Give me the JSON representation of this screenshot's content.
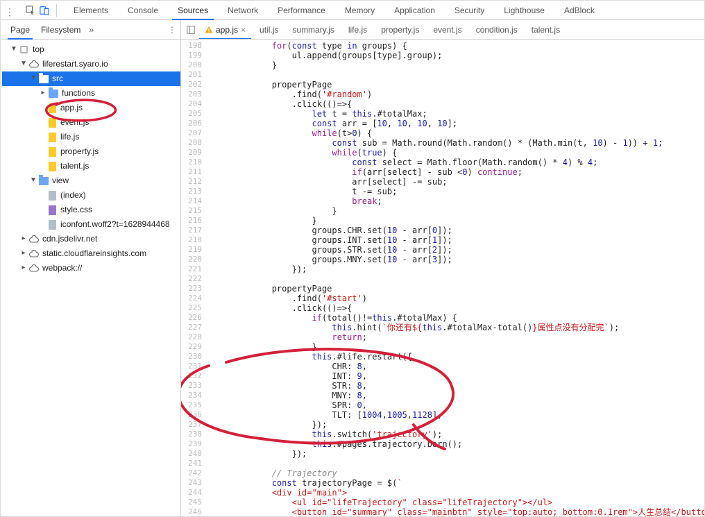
{
  "toolbar": {
    "tabs": [
      "Elements",
      "Console",
      "Sources",
      "Network",
      "Performance",
      "Memory",
      "Application",
      "Security",
      "Lighthouse",
      "AdBlock"
    ],
    "active_index": 2
  },
  "sidebar": {
    "tabs": {
      "page": "Page",
      "filesystem": "Filesystem"
    },
    "tree": {
      "top": "top",
      "domain": "liferestart.syaro.io",
      "src": "src",
      "functions": "functions",
      "files_root": [
        "app.js",
        "event.js",
        "life.js",
        "property.js",
        "talent.js"
      ],
      "view": "view",
      "view_files": [
        "(index)",
        "style.css",
        "iconfont.woff2?t=1628944468"
      ],
      "others": [
        "cdn.jsdelivr.net",
        "static.cloudflareinsights.com",
        "webpack://"
      ]
    }
  },
  "editor_tabs": [
    "app.js",
    "util.js",
    "summary.js",
    "life.js",
    "property.js",
    "event.js",
    "condition.js",
    "talent.js"
  ],
  "editor_active_tab_index": 0,
  "code_start_line": 198,
  "code_lines": [
    {
      "ind": 6,
      "parts": [
        {
          "t": "for",
          "c": "kw"
        },
        {
          "t": "("
        },
        {
          "t": "const ",
          "c": "blue"
        },
        {
          "t": "type "
        },
        {
          "t": "in ",
          "c": "blue"
        },
        {
          "t": "groups) {"
        }
      ]
    },
    {
      "ind": 8,
      "parts": [
        {
          "t": "ul.append(groups[type].group);"
        }
      ]
    },
    {
      "ind": 6,
      "parts": [
        {
          "t": "}"
        }
      ]
    },
    {
      "ind": 0,
      "parts": [
        {
          "t": ""
        }
      ]
    },
    {
      "ind": 6,
      "parts": [
        {
          "t": "propertyPage"
        }
      ]
    },
    {
      "ind": 8,
      "parts": [
        {
          "t": ".find("
        },
        {
          "t": "'#random'",
          "c": "red"
        },
        {
          "t": ")"
        }
      ]
    },
    {
      "ind": 8,
      "parts": [
        {
          "t": ".click(()=>{"
        }
      ]
    },
    {
      "ind": 10,
      "parts": [
        {
          "t": "let ",
          "c": "blue"
        },
        {
          "t": "t = "
        },
        {
          "t": "this",
          "c": "blue"
        },
        {
          "t": ".#totalMax;"
        }
      ]
    },
    {
      "ind": 10,
      "parts": [
        {
          "t": "const ",
          "c": "blue"
        },
        {
          "t": "arr = ["
        },
        {
          "t": "10",
          "c": "blue"
        },
        {
          "t": ", "
        },
        {
          "t": "10",
          "c": "blue"
        },
        {
          "t": ", "
        },
        {
          "t": "10",
          "c": "blue"
        },
        {
          "t": ", "
        },
        {
          "t": "10",
          "c": "blue"
        },
        {
          "t": "];"
        }
      ]
    },
    {
      "ind": 10,
      "parts": [
        {
          "t": "while",
          "c": "kw"
        },
        {
          "t": "(t>"
        },
        {
          "t": "0",
          "c": "blue"
        },
        {
          "t": ") {"
        }
      ]
    },
    {
      "ind": 12,
      "parts": [
        {
          "t": "const ",
          "c": "blue"
        },
        {
          "t": "sub = Math.round(Math.random() * (Math.min(t, "
        },
        {
          "t": "10",
          "c": "blue"
        },
        {
          "t": ") - "
        },
        {
          "t": "1",
          "c": "blue"
        },
        {
          "t": ")) + "
        },
        {
          "t": "1",
          "c": "blue"
        },
        {
          "t": ";"
        }
      ]
    },
    {
      "ind": 12,
      "parts": [
        {
          "t": "while",
          "c": "kw"
        },
        {
          "t": "("
        },
        {
          "t": "true",
          "c": "blue"
        },
        {
          "t": ") {"
        }
      ]
    },
    {
      "ind": 14,
      "parts": [
        {
          "t": "const ",
          "c": "blue"
        },
        {
          "t": "select = Math.floor(Math.random() * "
        },
        {
          "t": "4",
          "c": "blue"
        },
        {
          "t": ") % "
        },
        {
          "t": "4",
          "c": "blue"
        },
        {
          "t": ";"
        }
      ]
    },
    {
      "ind": 14,
      "parts": [
        {
          "t": "if",
          "c": "kw"
        },
        {
          "t": "(arr[select] - sub <"
        },
        {
          "t": "0",
          "c": "blue"
        },
        {
          "t": ") "
        },
        {
          "t": "continue",
          "c": "kw"
        },
        {
          "t": ";"
        }
      ]
    },
    {
      "ind": 14,
      "parts": [
        {
          "t": "arr[select] -= sub;"
        }
      ]
    },
    {
      "ind": 14,
      "parts": [
        {
          "t": "t -= sub;"
        }
      ]
    },
    {
      "ind": 14,
      "parts": [
        {
          "t": "break",
          "c": "kw"
        },
        {
          "t": ";"
        }
      ]
    },
    {
      "ind": 12,
      "parts": [
        {
          "t": "}"
        }
      ]
    },
    {
      "ind": 10,
      "parts": [
        {
          "t": "}"
        }
      ]
    },
    {
      "ind": 10,
      "parts": [
        {
          "t": "groups.CHR.set("
        },
        {
          "t": "10",
          "c": "blue"
        },
        {
          "t": " - arr["
        },
        {
          "t": "0",
          "c": "blue"
        },
        {
          "t": "]);"
        }
      ]
    },
    {
      "ind": 10,
      "parts": [
        {
          "t": "groups.INT.set("
        },
        {
          "t": "10",
          "c": "blue"
        },
        {
          "t": " - arr["
        },
        {
          "t": "1",
          "c": "blue"
        },
        {
          "t": "]);"
        }
      ]
    },
    {
      "ind": 10,
      "parts": [
        {
          "t": "groups.STR.set("
        },
        {
          "t": "10",
          "c": "blue"
        },
        {
          "t": " - arr["
        },
        {
          "t": "2",
          "c": "blue"
        },
        {
          "t": "]);"
        }
      ]
    },
    {
      "ind": 10,
      "parts": [
        {
          "t": "groups.MNY.set("
        },
        {
          "t": "10",
          "c": "blue"
        },
        {
          "t": " - arr["
        },
        {
          "t": "3",
          "c": "blue"
        },
        {
          "t": "]);"
        }
      ]
    },
    {
      "ind": 8,
      "parts": [
        {
          "t": "});"
        }
      ]
    },
    {
      "ind": 0,
      "parts": [
        {
          "t": ""
        }
      ]
    },
    {
      "ind": 6,
      "parts": [
        {
          "t": "propertyPage"
        }
      ]
    },
    {
      "ind": 8,
      "parts": [
        {
          "t": ".find("
        },
        {
          "t": "'#start'",
          "c": "red"
        },
        {
          "t": ")"
        }
      ]
    },
    {
      "ind": 8,
      "parts": [
        {
          "t": ".click(()=>{"
        }
      ]
    },
    {
      "ind": 10,
      "parts": [
        {
          "t": "if",
          "c": "kw"
        },
        {
          "t": "(total()!="
        },
        {
          "t": "this",
          "c": "blue"
        },
        {
          "t": ".#totalMax) {"
        }
      ]
    },
    {
      "ind": 12,
      "parts": [
        {
          "t": "this",
          "c": "blue"
        },
        {
          "t": ".hint("
        },
        {
          "t": "`你还有${",
          "c": "red"
        },
        {
          "t": "this",
          "c": "blue"
        },
        {
          "t": ".#totalMax-total()"
        },
        {
          "t": "}属性点没有分配完`",
          "c": "red"
        },
        {
          "t": ");"
        }
      ]
    },
    {
      "ind": 12,
      "parts": [
        {
          "t": "return",
          "c": "kw"
        },
        {
          "t": ";"
        }
      ]
    },
    {
      "ind": 10,
      "parts": [
        {
          "t": "}"
        }
      ]
    },
    {
      "ind": 10,
      "parts": [
        {
          "t": "this",
          "c": "blue"
        },
        {
          "t": ".#life.restart({"
        }
      ]
    },
    {
      "ind": 12,
      "parts": [
        {
          "t": "CHR: "
        },
        {
          "t": "8",
          "c": "blue"
        },
        {
          "t": ","
        }
      ]
    },
    {
      "ind": 12,
      "parts": [
        {
          "t": "INT: "
        },
        {
          "t": "9",
          "c": "blue"
        },
        {
          "t": ","
        }
      ]
    },
    {
      "ind": 12,
      "parts": [
        {
          "t": "STR: "
        },
        {
          "t": "8",
          "c": "blue"
        },
        {
          "t": ","
        }
      ]
    },
    {
      "ind": 12,
      "parts": [
        {
          "t": "MNY: "
        },
        {
          "t": "8",
          "c": "blue"
        },
        {
          "t": ","
        }
      ]
    },
    {
      "ind": 12,
      "parts": [
        {
          "t": "SPR: "
        },
        {
          "t": "0",
          "c": "blue"
        },
        {
          "t": ","
        }
      ]
    },
    {
      "ind": 12,
      "parts": [
        {
          "t": "TLT: ["
        },
        {
          "t": "1004",
          "c": "blue"
        },
        {
          "t": ","
        },
        {
          "t": "1005",
          "c": "blue"
        },
        {
          "t": ","
        },
        {
          "t": "1128",
          "c": "blue"
        },
        {
          "t": "],"
        }
      ]
    },
    {
      "ind": 10,
      "parts": [
        {
          "t": "});"
        }
      ]
    },
    {
      "ind": 10,
      "parts": [
        {
          "t": "this",
          "c": "blue"
        },
        {
          "t": ".switch("
        },
        {
          "t": "'trajectory'",
          "c": "red"
        },
        {
          "t": ");"
        }
      ]
    },
    {
      "ind": 10,
      "parts": [
        {
          "t": "this",
          "c": "blue"
        },
        {
          "t": ".#pages.trajectory.born();"
        }
      ]
    },
    {
      "ind": 8,
      "parts": [
        {
          "t": "});"
        }
      ]
    },
    {
      "ind": 0,
      "parts": [
        {
          "t": ""
        }
      ]
    },
    {
      "ind": 6,
      "parts": [
        {
          "t": "// Trajectory",
          "c": "comm"
        }
      ]
    },
    {
      "ind": 6,
      "parts": [
        {
          "t": "const ",
          "c": "blue"
        },
        {
          "t": "trajectoryPage = $("
        },
        {
          "t": "`",
          "c": "red"
        }
      ]
    },
    {
      "ind": 6,
      "parts": [
        {
          "t": "<div id=\"main\">",
          "c": "red"
        }
      ]
    },
    {
      "ind": 8,
      "parts": [
        {
          "t": "<ul id=\"lifeTrajectory\" class=\"lifeTrajectory\"></ul>",
          "c": "red"
        }
      ]
    },
    {
      "ind": 8,
      "parts": [
        {
          "t": "<button id=\"summary\" class=\"mainbtn\" style=\"top:auto; bottom:0.1rem\">人生总结</button>",
          "c": "red"
        }
      ]
    }
  ]
}
